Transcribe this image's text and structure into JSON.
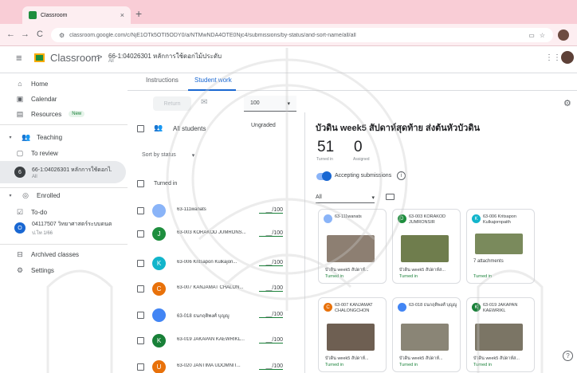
{
  "browser": {
    "tab_title": "Classroom",
    "tab_close": "×",
    "new_tab": "+",
    "back": "←",
    "forward": "→",
    "reload": "C",
    "url": "classroom.google.com/c/NjE1OTk5OTI5ODY0/a/NTMwNDA4OTE0Njc4/submissions/by-status/and-sort-name/all/all"
  },
  "header": {
    "app_title": "Classroom",
    "separator": ">",
    "class_name": "66-1:04026301 หลักการใช้ดอกไม้ประดับ",
    "class_sub": "All"
  },
  "sidebar": {
    "home": "Home",
    "calendar": "Calendar",
    "resources": "Resources",
    "resources_badge": "New",
    "teaching": "Teaching",
    "to_review": "To review",
    "teaching_class": {
      "letter": "6",
      "name": "66-1:04026301 หลักการใช้ดอกไ...",
      "sub": "All"
    },
    "enrolled": "Enrolled",
    "todo": "To-do",
    "enrolled_class": {
      "letter": "O",
      "name": "04117507 วิทยาศาสตร์ระบบดนตรี...",
      "sub": "ป.โท 1/66"
    },
    "archived": "Archived classes",
    "settings": "Settings"
  },
  "main": {
    "tab_instructions": "Instructions",
    "tab_student_work": "Student work",
    "return_button": "Return",
    "points": "100",
    "all_students": "All students",
    "ungraded": "Ungraded",
    "sort_by": "Sort by status",
    "turned_in_section": "Turned in",
    "students": [
      {
        "letter": "",
        "name": "63-111wanats",
        "grade": "__/100",
        "color": "#8ab4f8"
      },
      {
        "letter": "J",
        "name": "63-003 KORAKOD JUMRONS...",
        "grade": "__/100",
        "color": "#1e8e3e"
      },
      {
        "letter": "K",
        "name": "63-006 Kritsapon Kulkajon...",
        "grade": "__/100",
        "color": "#12b5cb"
      },
      {
        "letter": "C",
        "name": "63-007 KANJAMAT CHALON...",
        "grade": "__/100",
        "color": "#e8710a"
      },
      {
        "letter": "",
        "name": "63-018 ธนกฤติพงศ์ บุญญู",
        "grade": "__/100",
        "color": "#4285f4"
      },
      {
        "letter": "K",
        "name": "63-019 JAKAPAN KAEWRIKL...",
        "grade": "__/100",
        "color": "#188038"
      },
      {
        "letter": "U",
        "name": "63-020 JANTIMA UDOMNIT...",
        "grade": "__/100",
        "color": "#e8710a"
      }
    ]
  },
  "detail": {
    "title": "บัวดิน week5 สัปดาห์สุดท้าย ส่งต้นหัวบัวดิน",
    "turned_in_count": "51",
    "turned_in_label": "Turned in",
    "assigned_count": "0",
    "assigned_label": "Assigned",
    "accepting": "Accepting submissions",
    "filter": "All",
    "cards": [
      {
        "letter": "",
        "name": "63-111wanats",
        "attach": "",
        "file": "บัวดิน week5 สัปดาห์...",
        "status": "Turned in",
        "color": "#8ab4f8",
        "thumb": "#8d7f72"
      },
      {
        "letter": "J",
        "name": "63-003 KORAKOD JUMRONSIR",
        "attach": "",
        "file": "บัวดิน week5 สัปดาห์ส...",
        "status": "Turned in",
        "color": "#1e8e3e",
        "thumb": "#6f7d4d"
      },
      {
        "letter": "K",
        "name": "63-006 Kritsapon Kulkajornpaith",
        "attach": "7 attachments",
        "file": "",
        "status": "Turned in",
        "color": "#12b5cb",
        "thumb": "#7a8a5c"
      },
      {
        "letter": "C",
        "name": "63-007 KANJAMAT CHALONGCHON",
        "attach": "",
        "file": "บัวดิน week5 สัปดาห์...",
        "status": "Turned in",
        "color": "#e8710a",
        "thumb": "#6e5f52"
      },
      {
        "letter": "",
        "name": "63-018 ธนกฤติพงศ์ บุญญู",
        "attach": "",
        "file": "บัวดิน week5 สัปดาห์...",
        "status": "Turned in",
        "color": "#4285f4",
        "thumb": "#8a8576"
      },
      {
        "letter": "K",
        "name": "63-019 JAKAPAN KAEWRIKL",
        "attach": "",
        "file": "บัวดิน week5 สัปดาห์ส...",
        "status": "Turned in",
        "color": "#188038",
        "thumb": "#7b7565"
      }
    ]
  },
  "icons": {
    "menu": "hamburger-icon",
    "home": "home-icon",
    "calendar": "calendar-icon",
    "resources": "book-icon",
    "teaching": "people-icon",
    "review": "folder-icon",
    "enrolled": "school-icon",
    "todo": "checklist-icon",
    "archive": "archive-icon",
    "settings": "gear-icon",
    "mail": "mail-icon",
    "info": "info-icon",
    "help": "help-icon"
  },
  "colors": {
    "accent": "#1967d2",
    "brand_green": "#1e8e3e",
    "turned_in": "#188038"
  }
}
